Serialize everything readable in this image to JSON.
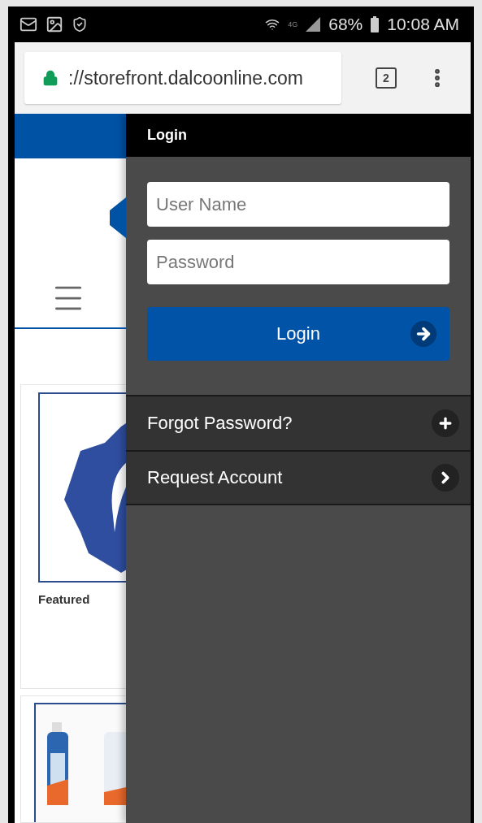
{
  "status_bar": {
    "network_type": "4G",
    "battery": "68%",
    "time": "10:08 AM"
  },
  "browser": {
    "url": "://storefront.dalcoonline.com",
    "tab_count": "2"
  },
  "page": {
    "products": [
      {
        "kind": "picture",
        "caption": "Featured"
      },
      {
        "kind": "picture"
      }
    ]
  },
  "drawer": {
    "title": "Login",
    "fields": [
      {
        "placeholder": "User Name"
      },
      {
        "placeholder": "Password"
      }
    ],
    "button": {
      "label": "Login"
    },
    "links": [
      {
        "label": "Forgot Password?",
        "kind": "expand"
      },
      {
        "label": "Request Account",
        "kind": "next"
      }
    ]
  }
}
